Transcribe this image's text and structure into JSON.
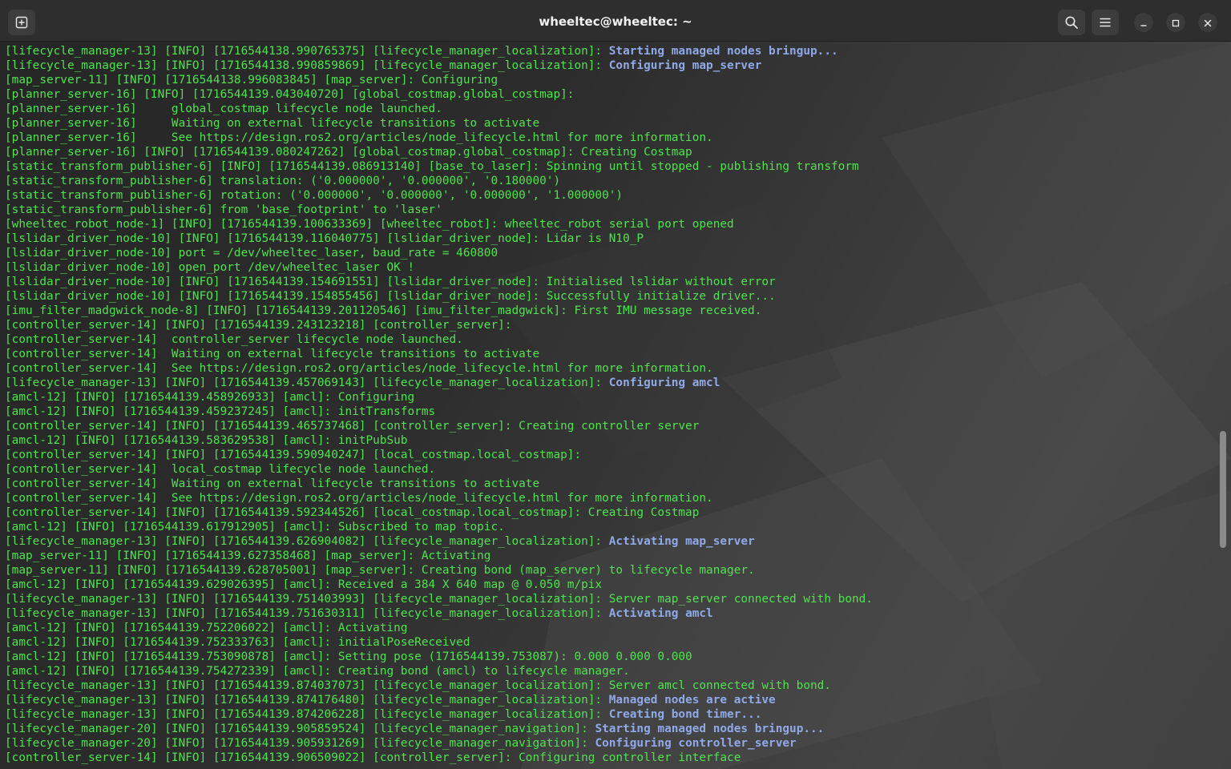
{
  "window": {
    "title": "wheeltec@wheeltec: ~",
    "icons": {
      "new_tab": "new-tab-icon",
      "search": "search-icon",
      "menu": "hamburger-menu-icon",
      "minimize": "minimize-icon",
      "maximize": "maximize-icon",
      "close": "close-icon"
    }
  },
  "colors": {
    "log_text": "#4fe34f",
    "highlight_text": "#8fa9e8",
    "titlebar": "#2e2e2e"
  },
  "log": [
    {
      "prefix": "[lifecycle_manager-13] [INFO] [1716544138.990765375] [lifecycle_manager_localization]: ",
      "hl": "Starting managed nodes bringup..."
    },
    {
      "prefix": "[lifecycle_manager-13] [INFO] [1716544138.990859869] [lifecycle_manager_localization]: ",
      "hl": "Configuring map_server"
    },
    {
      "prefix": "[map_server-11] [INFO] [1716544138.996083845] [map_server]: Configuring",
      "hl": ""
    },
    {
      "prefix": "[planner_server-16] [INFO] [1716544139.043040720] [global_costmap.global_costmap]:",
      "hl": ""
    },
    {
      "prefix": "[planner_server-16]     global_costmap lifecycle node launched.",
      "hl": ""
    },
    {
      "prefix": "[planner_server-16]     Waiting on external lifecycle transitions to activate",
      "hl": ""
    },
    {
      "prefix": "[planner_server-16]     See https://design.ros2.org/articles/node_lifecycle.html for more information.",
      "hl": ""
    },
    {
      "prefix": "[planner_server-16] [INFO] [1716544139.080247262] [global_costmap.global_costmap]: Creating Costmap",
      "hl": ""
    },
    {
      "prefix": "[static_transform_publisher-6] [INFO] [1716544139.086913140] [base_to_laser]: Spinning until stopped - publishing transform",
      "hl": ""
    },
    {
      "prefix": "[static_transform_publisher-6] translation: ('0.000000', '0.000000', '0.180000')",
      "hl": ""
    },
    {
      "prefix": "[static_transform_publisher-6] rotation: ('0.000000', '0.000000', '0.000000', '1.000000')",
      "hl": ""
    },
    {
      "prefix": "[static_transform_publisher-6] from 'base_footprint' to 'laser'",
      "hl": ""
    },
    {
      "prefix": "[wheeltec_robot_node-1] [INFO] [1716544139.100633369] [wheeltec_robot]: wheeltec_robot serial port opened",
      "hl": ""
    },
    {
      "prefix": "[lslidar_driver_node-10] [INFO] [1716544139.116040775] [lslidar_driver_node]: Lidar is N10_P",
      "hl": ""
    },
    {
      "prefix": "[lslidar_driver_node-10] port = /dev/wheeltec_laser, baud_rate = 460800",
      "hl": ""
    },
    {
      "prefix": "[lslidar_driver_node-10] open_port /dev/wheeltec_laser OK !",
      "hl": ""
    },
    {
      "prefix": "[lslidar_driver_node-10] [INFO] [1716544139.154691551] [lslidar_driver_node]: Initialised lslidar without error",
      "hl": ""
    },
    {
      "prefix": "[lslidar_driver_node-10] [INFO] [1716544139.154855456] [lslidar_driver_node]: Successfully initialize driver...",
      "hl": ""
    },
    {
      "prefix": "[imu_filter_madgwick_node-8] [INFO] [1716544139.201120546] [imu_filter_madgwick]: First IMU message received.",
      "hl": ""
    },
    {
      "prefix": "[controller_server-14] [INFO] [1716544139.243123218] [controller_server]:",
      "hl": ""
    },
    {
      "prefix": "[controller_server-14]  controller_server lifecycle node launched.",
      "hl": ""
    },
    {
      "prefix": "[controller_server-14]  Waiting on external lifecycle transitions to activate",
      "hl": ""
    },
    {
      "prefix": "[controller_server-14]  See https://design.ros2.org/articles/node_lifecycle.html for more information.",
      "hl": ""
    },
    {
      "prefix": "[lifecycle_manager-13] [INFO] [1716544139.457069143] [lifecycle_manager_localization]: ",
      "hl": "Configuring amcl"
    },
    {
      "prefix": "[amcl-12] [INFO] [1716544139.458926933] [amcl]: Configuring",
      "hl": ""
    },
    {
      "prefix": "[amcl-12] [INFO] [1716544139.459237245] [amcl]: initTransforms",
      "hl": ""
    },
    {
      "prefix": "[controller_server-14] [INFO] [1716544139.465737468] [controller_server]: Creating controller server",
      "hl": ""
    },
    {
      "prefix": "[amcl-12] [INFO] [1716544139.583629538] [amcl]: initPubSub",
      "hl": ""
    },
    {
      "prefix": "[controller_server-14] [INFO] [1716544139.590940247] [local_costmap.local_costmap]:",
      "hl": ""
    },
    {
      "prefix": "[controller_server-14]  local_costmap lifecycle node launched.",
      "hl": ""
    },
    {
      "prefix": "[controller_server-14]  Waiting on external lifecycle transitions to activate",
      "hl": ""
    },
    {
      "prefix": "[controller_server-14]  See https://design.ros2.org/articles/node_lifecycle.html for more information.",
      "hl": ""
    },
    {
      "prefix": "[controller_server-14] [INFO] [1716544139.592344526] [local_costmap.local_costmap]: Creating Costmap",
      "hl": ""
    },
    {
      "prefix": "[amcl-12] [INFO] [1716544139.617912905] [amcl]: Subscribed to map topic.",
      "hl": ""
    },
    {
      "prefix": "[lifecycle_manager-13] [INFO] [1716544139.626904082] [lifecycle_manager_localization]: ",
      "hl": "Activating map_server"
    },
    {
      "prefix": "[map_server-11] [INFO] [1716544139.627358468] [map_server]: Activating",
      "hl": ""
    },
    {
      "prefix": "[map_server-11] [INFO] [1716544139.628705001] [map_server]: Creating bond (map_server) to lifecycle manager.",
      "hl": ""
    },
    {
      "prefix": "[amcl-12] [INFO] [1716544139.629026395] [amcl]: Received a 384 X 640 map @ 0.050 m/pix",
      "hl": ""
    },
    {
      "prefix": "[lifecycle_manager-13] [INFO] [1716544139.751403993] [lifecycle_manager_localization]: Server map_server connected with bond.",
      "hl": ""
    },
    {
      "prefix": "[lifecycle_manager-13] [INFO] [1716544139.751630311] [lifecycle_manager_localization]: ",
      "hl": "Activating amcl"
    },
    {
      "prefix": "[amcl-12] [INFO] [1716544139.752206022] [amcl]: Activating",
      "hl": ""
    },
    {
      "prefix": "[amcl-12] [INFO] [1716544139.752333763] [amcl]: initialPoseReceived",
      "hl": ""
    },
    {
      "prefix": "[amcl-12] [INFO] [1716544139.753090878] [amcl]: Setting pose (1716544139.753087): 0.000 0.000 0.000",
      "hl": ""
    },
    {
      "prefix": "[amcl-12] [INFO] [1716544139.754272339] [amcl]: Creating bond (amcl) to lifecycle manager.",
      "hl": ""
    },
    {
      "prefix": "[lifecycle_manager-13] [INFO] [1716544139.874037073] [lifecycle_manager_localization]: Server amcl connected with bond.",
      "hl": ""
    },
    {
      "prefix": "[lifecycle_manager-13] [INFO] [1716544139.874176480] [lifecycle_manager_localization]: ",
      "hl": "Managed nodes are active"
    },
    {
      "prefix": "[lifecycle_manager-13] [INFO] [1716544139.874206228] [lifecycle_manager_localization]: ",
      "hl": "Creating bond timer..."
    },
    {
      "prefix": "[lifecycle_manager-20] [INFO] [1716544139.905859524] [lifecycle_manager_navigation]: ",
      "hl": "Starting managed nodes bringup..."
    },
    {
      "prefix": "[lifecycle_manager-20] [INFO] [1716544139.905931269] [lifecycle_manager_navigation]: ",
      "hl": "Configuring controller_server"
    },
    {
      "prefix": "[controller_server-14] [INFO] [1716544139.906509022] [controller_server]: Configuring controller interface",
      "hl": ""
    }
  ]
}
